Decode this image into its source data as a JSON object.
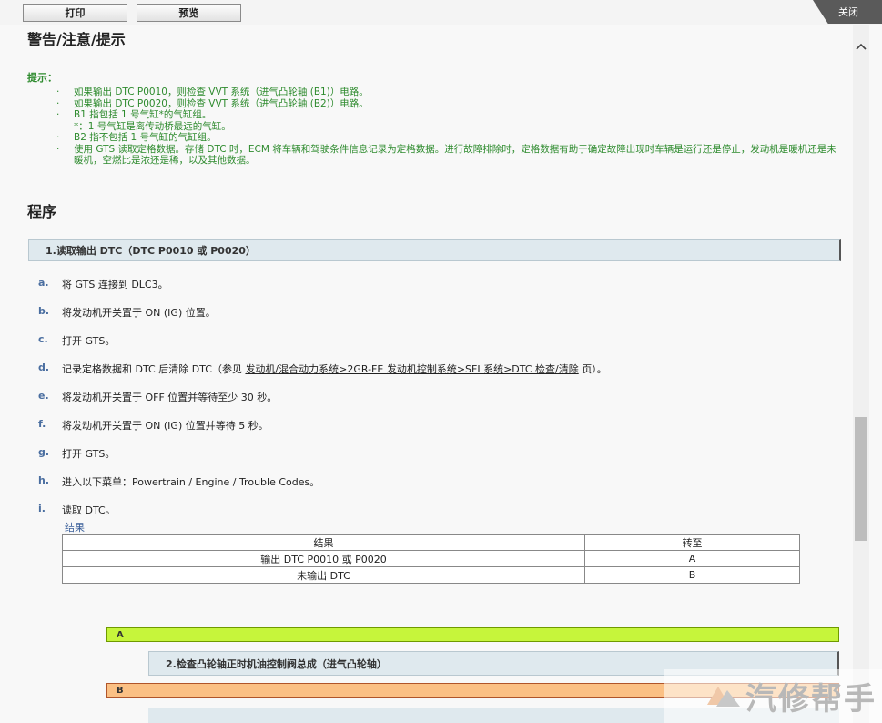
{
  "toolbar": {
    "print_label": "打印",
    "preview_label": "预览",
    "close_label": "关闭"
  },
  "warning_title": "警告/注意/提示",
  "hint": {
    "label": "提示：",
    "items": [
      {
        "bullet": "·",
        "text": "如果输出 DTC P0010，则检查 VVT 系统（进气凸轮轴 (B1)）电路。"
      },
      {
        "bullet": "·",
        "text": "如果输出 DTC P0020，则检查 VVT 系统（进气凸轮轴 (B2)）电路。"
      },
      {
        "bullet": "·",
        "text": "B1 指包括 1 号气缸*的气缸组。"
      },
      {
        "bullet": "",
        "text": "*：1 号气缸是离传动桥最远的气缸。"
      },
      {
        "bullet": "·",
        "text": "B2 指不包括 1 号气缸的气缸组。"
      },
      {
        "bullet": "·",
        "text": "使用 GTS 读取定格数据。存储 DTC 时，ECM 将车辆和驾驶条件信息记录为定格数据。进行故障排除时，定格数据有助于确定故障出现时车辆是运行还是停止，发动机是暖机还是未暖机，空燃比是浓还是稀，以及其他数据。"
      }
    ]
  },
  "procedure_title": "程序",
  "step1_title": "1.读取输出 DTC（DTC P0010 或 P0020）",
  "substeps": {
    "a": {
      "letter": "a.",
      "text": "将 GTS 连接到 DLC3。"
    },
    "b": {
      "letter": "b.",
      "text": "将发动机开关置于 ON (IG) 位置。"
    },
    "c": {
      "letter": "c.",
      "text": "打开 GTS。"
    },
    "d": {
      "letter": "d.",
      "text_before": "记录定格数据和 DTC 后清除 DTC（参见 ",
      "link": "发动机/混合动力系统>2GR-FE 发动机控制系统>SFI 系统>DTC 检查/清除",
      "text_after": " 页）。"
    },
    "e": {
      "letter": "e.",
      "text": "将发动机开关置于 OFF 位置并等待至少 30 秒。"
    },
    "f": {
      "letter": "f.",
      "text": "将发动机开关置于 ON (IG) 位置并等待 5 秒。"
    },
    "g": {
      "letter": "g.",
      "text": "打开 GTS。"
    },
    "h": {
      "letter": "h.",
      "text": "进入以下菜单：Powertrain / Engine / Trouble Codes。"
    },
    "i": {
      "letter": "i.",
      "text": "读取 DTC。"
    }
  },
  "results": {
    "caption": "结果",
    "headers": [
      "结果",
      "转至"
    ],
    "rows": [
      [
        "输出 DTC P0010 或 P0020",
        "A"
      ],
      [
        "未输出 DTC",
        "B"
      ]
    ]
  },
  "branch_a_label": "A",
  "step2_title": "2.检查凸轮轴正时机油控制阀总成（进气凸轮轴）",
  "branch_b_label": "B",
  "watermark_text": "汽修帮手",
  "colors": {
    "hint_green": "#2e8b2e",
    "branch_a": "#c6f53b",
    "branch_b": "#fbc084",
    "step_bar": "#dfe9ee"
  }
}
